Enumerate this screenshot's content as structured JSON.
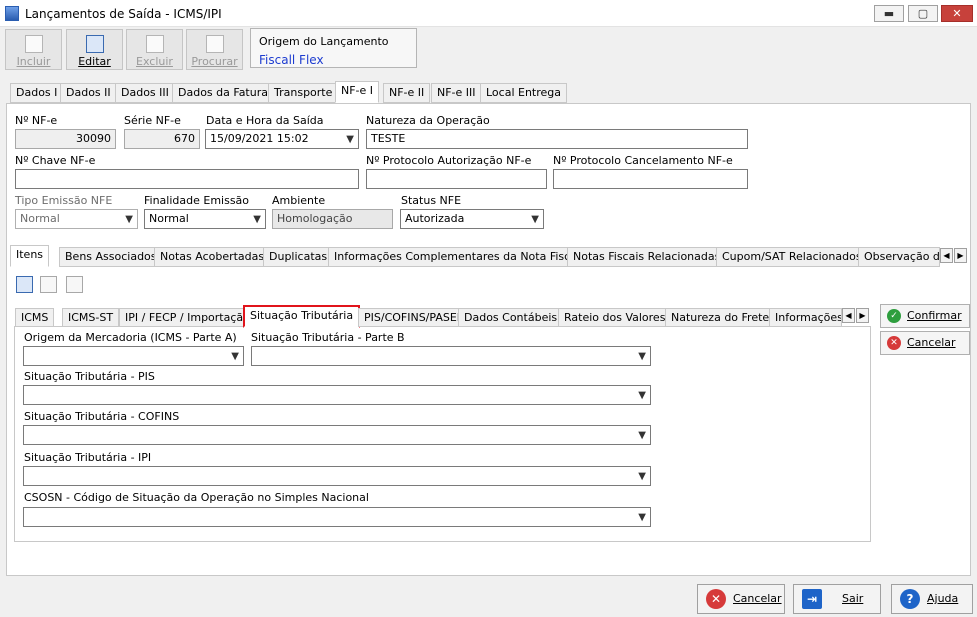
{
  "window": {
    "title": "Lançamentos de Saída - ICMS/IPI"
  },
  "toolbar": {
    "incluir": "Incluir",
    "editar": "Editar",
    "excluir": "Excluir",
    "procurar": "Procurar"
  },
  "origem": {
    "label": "Origem do Lançamento",
    "value": "Fiscall Flex"
  },
  "top_tabs": [
    "Dados I",
    "Dados II",
    "Dados III",
    "Dados da Fatura",
    "Transporte",
    "NF-e I",
    "NF-e II",
    "NF-e III",
    "Local Entrega"
  ],
  "form": {
    "nf_label": "Nº NF-e",
    "nf_value": "30090",
    "serie_label": "Série NF-e",
    "serie_value": "670",
    "data_label": "Data e Hora da Saída",
    "data_value": "15/09/2021 15:02",
    "natureza_label": "Natureza da Operação",
    "natureza_value": "TESTE",
    "chave_label": "Nº Chave NF-e",
    "chave_value": "",
    "protocolo_label": "Nº Protocolo Autorização NF-e",
    "protocolo_value": "",
    "cancel_label": "Nº Protocolo Cancelamento NF-e",
    "cancel_value": "",
    "tipo_label": "Tipo Emissão NFE",
    "tipo_value": "Normal",
    "final_label": "Finalidade Emissão",
    "final_value": "Normal",
    "ambiente_label": "Ambiente",
    "ambiente_value": "Homologação",
    "status_label": "Status NFE",
    "status_value": "Autorizada"
  },
  "mid_tabs": [
    "Itens",
    "Bens Associados",
    "Notas Acobertadas",
    "Duplicatas",
    "Informações Complementares da Nota Fiscal",
    "Notas Fiscais Relacionadas",
    "Cupom/SAT Relacionados",
    "Observação d"
  ],
  "inner_tabs": [
    "ICMS",
    "ICMS-ST",
    "IPI / FECP / Importação",
    "Situação Tributária",
    "PIS/COFINS/PASEP",
    "Dados Contábeis",
    "Rateio dos Valores",
    "Natureza do Frete",
    "Informações"
  ],
  "fields": {
    "origem_merc": "Origem da Mercadoria (ICMS - Parte A)",
    "sit_b": "Situação Tributária - Parte B",
    "sit_pis": "Situação Tributária - PIS",
    "sit_cofins": "Situação Tributária - COFINS",
    "sit_ipi": "Situação Tributária - IPI",
    "csosn": "CSOSN - Código de Situação da Operação no Simples Nacional"
  },
  "side": {
    "confirmar": "Confirmar",
    "cancelar": "Cancelar"
  },
  "bottom": {
    "cancelar": "Cancelar",
    "sair": "Sair",
    "ajuda": "Ajuda"
  },
  "colors": {
    "highlight": "#e1141b",
    "link": "#1d3cd0",
    "confirm": "#2e9e3e",
    "cancel": "#d63a3a",
    "help": "#1e64c8"
  }
}
